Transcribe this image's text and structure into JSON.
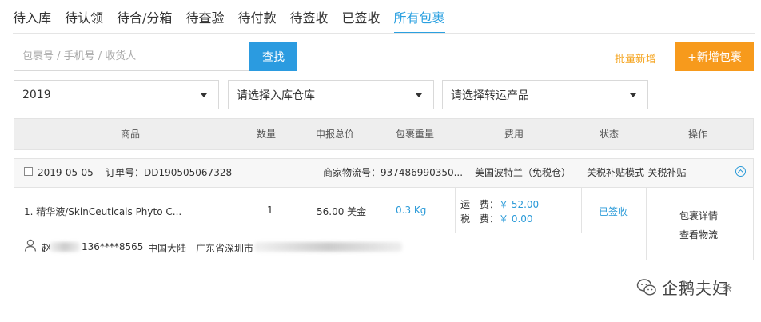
{
  "tabs": [
    {
      "label": "待入库"
    },
    {
      "label": "待认领"
    },
    {
      "label": "待合/分箱"
    },
    {
      "label": "待查验"
    },
    {
      "label": "待付款"
    },
    {
      "label": "待签收"
    },
    {
      "label": "已签收"
    },
    {
      "label": "所有包裹",
      "active": true
    }
  ],
  "search": {
    "placeholder": "包裹号 / 手机号 / 收货人",
    "value": "",
    "button_label": "查找"
  },
  "actions": {
    "batch_add": "批量新增",
    "add_package": "+新增包裹"
  },
  "filters": {
    "year": "2019",
    "warehouse": "请选择入库仓库",
    "product": "请选择转运产品"
  },
  "table": {
    "headers": [
      "商品",
      "数量",
      "申报总价",
      "包裹重量",
      "费用",
      "状态",
      "操作"
    ]
  },
  "order": {
    "date": "2019-05-05",
    "order_no": "订单号：DD190505067328",
    "tracking": "商家物流号：937486990350...",
    "route": "美国波特兰（免税仓）",
    "mode": "关税补贴模式-关税补贴",
    "item": "1. 精华液/SkinCeuticals Phyto C...",
    "quantity": "1",
    "declared_value": "56.00 美金",
    "weight": "0.3 Kg",
    "fees": {
      "shipping_label": "运　费：",
      "shipping_value": "￥ 52.00",
      "tax_label": "税　费：",
      "tax_value": "￥ 0.00"
    },
    "status": "已签收",
    "ops": {
      "detail": "包裹详情",
      "track": "查看物流"
    },
    "recipient": {
      "name_visible": "赵",
      "phone": "136****8565",
      "country": "中国大陆",
      "address_visible": "广东省深圳市"
    }
  },
  "watermark": {
    "text": "企鹅夫妇",
    "suffix": "条"
  }
}
